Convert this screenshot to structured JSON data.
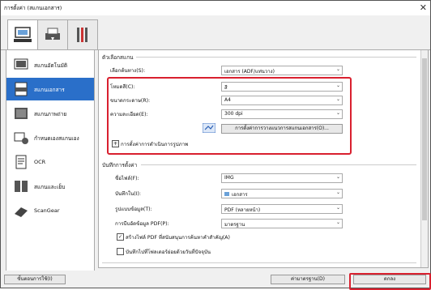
{
  "window": {
    "title": "การตั้งค่า (สแกนเอกสาร)",
    "close_glyph": "✕"
  },
  "tabs": [
    {
      "name": "scan-from-computer",
      "icon": "computer-scan-icon",
      "active": true
    },
    {
      "name": "scan-from-operation-panel",
      "icon": "scanner-panel-icon",
      "active": false
    },
    {
      "name": "general-settings",
      "icon": "tools-icon",
      "active": false
    }
  ],
  "sidebar": {
    "items": [
      {
        "label": "สแกนอัตโนมัติ",
        "icon": "auto-scan-icon",
        "active": false
      },
      {
        "label": "สแกนเอกสาร",
        "icon": "pdf-document-icon",
        "active": true
      },
      {
        "label": "สแกนภาพถ่าย",
        "icon": "photo-icon",
        "active": false
      },
      {
        "label": "กำหนดเองสแกนเอง",
        "icon": "custom-scan-icon",
        "active": false
      },
      {
        "label": "OCR",
        "icon": "ocr-icon",
        "active": false
      },
      {
        "label": "สแกนและเย็บ",
        "icon": "stitch-icon",
        "active": false
      },
      {
        "label": "ScanGear",
        "icon": "scangear-icon",
        "active": false
      }
    ]
  },
  "scan_options": {
    "heading": "ตัวเลือกสแกน",
    "source_label": "เลือกต้นทาง(S):",
    "source_value": "เอกสาร (ADF/แท่นวาง)",
    "color_mode_label": "โหมดสี(C):",
    "color_mode_value": "สี",
    "paper_size_label": "ขนาดกระดาษ(R):",
    "paper_size_value": "A4",
    "resolution_label": "ความละเอียด(E):",
    "resolution_value": "300 dpi",
    "driver_button": "การตั้งค่าการวางแนวการสแกนเอกสาร(O)...",
    "image_processing_label": "การตั้งค่าการดำเนินการรูปภาพ",
    "expand_glyph": "+"
  },
  "save_settings": {
    "heading": "บันทึกการตั้งค่า",
    "filename_label": "ชื่อไฟล์(F):",
    "filename_value": "IMG",
    "save_in_label": "บันทึกใน(I):",
    "save_in_value": "เอกสาร",
    "format_label": "รูปแบบข้อมูล(T):",
    "format_value": "PDF (หลายหน้า)",
    "compression_label": "การบีบอัดข้อมูล PDF(P):",
    "compression_value": "มาตรฐาน",
    "checkbox1_label": "สร้างไฟล์ PDF ที่สนับสนุนการค้นหาคำสำคัญ(A)",
    "checkbox1_checked": "✓",
    "checkbox2_label": "บันทึกไปที่โฟลเดอร์ย่อยด้วยวันที่ปัจจุบัน"
  },
  "footer": {
    "instructions": "ขั้นตอนการใช้(I)",
    "defaults": "ค่ามาตรฐาน(D)",
    "ok": "ตกลง"
  }
}
